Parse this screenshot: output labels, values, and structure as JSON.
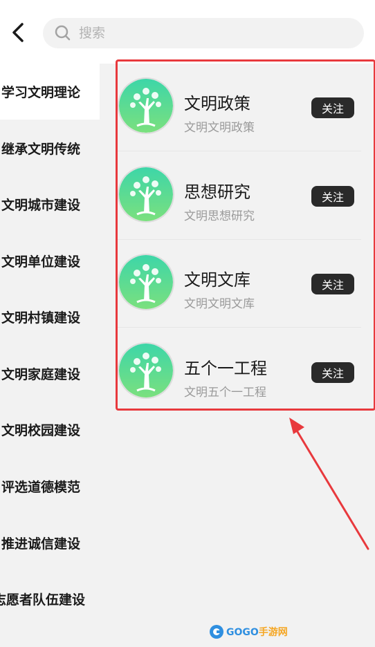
{
  "header": {
    "back_icon": "chevron-left-icon",
    "search_icon": "search-icon",
    "search_placeholder": "搜索"
  },
  "sidebar": {
    "items": [
      {
        "label": "学习文明理论",
        "active": true
      },
      {
        "label": "继承文明传统"
      },
      {
        "label": "文明城市建设"
      },
      {
        "label": "文明单位建设"
      },
      {
        "label": "文明村镇建设"
      },
      {
        "label": "文明家庭建设"
      },
      {
        "label": "文明校园建设"
      },
      {
        "label": "评选道德模范"
      },
      {
        "label": "推进诚信建设"
      },
      {
        "label": "志愿者队伍建设"
      }
    ]
  },
  "list": {
    "items": [
      {
        "title": "文明政策",
        "subtitle": "文明文明政策",
        "button": "关注"
      },
      {
        "title": "思想研究",
        "subtitle": "文明思想研究",
        "button": "关注"
      },
      {
        "title": "文明文库",
        "subtitle": "文明文明文库",
        "button": "关注"
      },
      {
        "title": "五个一工程",
        "subtitle": "文明五个一工程",
        "button": "关注"
      }
    ]
  },
  "watermark": {
    "text_a": "GOGO",
    "text_b": "手游网"
  },
  "colors": {
    "accent_red": "#e8393d",
    "avatar_gradient_top": "#3dd6a8",
    "avatar_gradient_bottom": "#7be07e",
    "follow_button_bg": "#2a2a2a",
    "sidebar_bg": "#f2f2f2"
  }
}
